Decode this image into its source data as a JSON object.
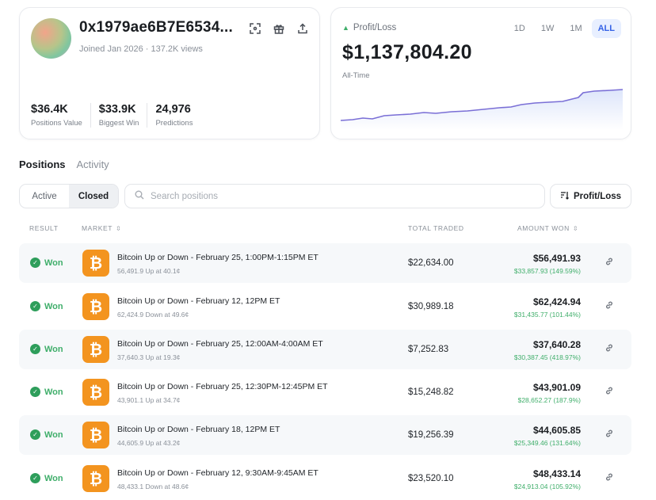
{
  "profile": {
    "username": "0x1979ae6B7E6534...",
    "meta": "Joined Jan 2026 · 137.2K views",
    "stats": [
      {
        "value": "$36.4K",
        "label": "Positions Value"
      },
      {
        "value": "$33.9K",
        "label": "Biggest Win"
      },
      {
        "value": "24,976",
        "label": "Predictions"
      }
    ],
    "icons": [
      "expand-icon",
      "gift-icon",
      "share-icon"
    ]
  },
  "pnl": {
    "label": "Profit/Loss",
    "value": "$1,137,804.20",
    "period": "All-Time",
    "ranges": [
      "1D",
      "1W",
      "1M",
      "ALL"
    ],
    "active_range": "ALL",
    "chart_color": "#7a6fd6"
  },
  "tabs": {
    "positions": "Positions",
    "activity": "Activity"
  },
  "filters": {
    "active": "Active",
    "closed": "Closed",
    "search_placeholder": "Search positions",
    "sort_label": "Profit/Loss"
  },
  "table": {
    "headers": {
      "result": "RESULT",
      "market": "MARKET",
      "total_traded": "TOTAL TRADED",
      "amount_won": "AMOUNT WON"
    },
    "rows": [
      {
        "result": "Won",
        "title": "Bitcoin Up or Down - February 25, 1:00PM-1:15PM ET",
        "sub": "56,491.9 Up at 40.1¢",
        "traded": "$22,634.00",
        "amount": "$56,491.93",
        "profit": "$33,857.93 (149.59%)"
      },
      {
        "result": "Won",
        "title": "Bitcoin Up or Down - February 12, 12PM ET",
        "sub": "62,424.9 Down at 49.6¢",
        "traded": "$30,989.18",
        "amount": "$62,424.94",
        "profit": "$31,435.77 (101.44%)"
      },
      {
        "result": "Won",
        "title": "Bitcoin Up or Down - February 25, 12:00AM-4:00AM ET",
        "sub": "37,640.3 Up at 19.3¢",
        "traded": "$7,252.83",
        "amount": "$37,640.28",
        "profit": "$30,387.45 (418.97%)"
      },
      {
        "result": "Won",
        "title": "Bitcoin Up or Down - February 25, 12:30PM-12:45PM ET",
        "sub": "43,901.1 Up at 34.7¢",
        "traded": "$15,248.82",
        "amount": "$43,901.09",
        "profit": "$28,652.27 (187.9%)"
      },
      {
        "result": "Won",
        "title": "Bitcoin Up or Down - February 18, 12PM ET",
        "sub": "44,605.9 Up at 43.2¢",
        "traded": "$19,256.39",
        "amount": "$44,605.85",
        "profit": "$25,349.46 (131.64%)"
      },
      {
        "result": "Won",
        "title": "Bitcoin Up or Down - February 12, 9:30AM-9:45AM ET",
        "sub": "48,433.1 Down at 48.6¢",
        "traded": "$23,520.10",
        "amount": "$48,433.14",
        "profit": "$24,913.04 (105.92%)"
      }
    ]
  },
  "colors": {
    "won_green": "#3fae6a",
    "bitcoin_orange": "#f3941f",
    "accent_blue": "#3562e6"
  }
}
